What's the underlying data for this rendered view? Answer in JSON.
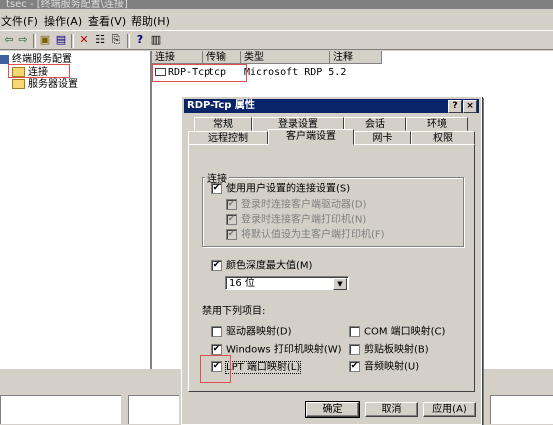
{
  "window": {
    "title": "tsec - [终端服务配置\\连接]"
  },
  "menu": [
    "文件(F)",
    "操作(A)",
    "查看(V)",
    "帮助(H)"
  ],
  "toolbar": {
    "icons": [
      "back-icon",
      "forward-icon",
      "folder-up-icon",
      "show-tree-icon",
      "delete-icon",
      "properties-icon",
      "export-icon",
      "help-icon",
      "view-icon"
    ],
    "glyphs": [
      "⇦",
      "⇨",
      "▣",
      "▤",
      "✕",
      "☷",
      "⎘",
      "?",
      "▥"
    ]
  },
  "tree": {
    "root": "终端服务配置",
    "items": [
      "连接",
      "服务器设置"
    ]
  },
  "list": {
    "columns": [
      "连接",
      "传输",
      "类型",
      "注释"
    ],
    "rows": [
      {
        "name": "RDP-Tcp",
        "transport": "tcp",
        "type": "Microsoft RDP 5.2",
        "comment": ""
      }
    ]
  },
  "dialog": {
    "title": "RDP-Tcp 属性",
    "help_btn": "?",
    "close_btn": "×",
    "tabs_back": [
      "常规",
      "登录设置",
      "会话",
      "环境"
    ],
    "tabs_front": [
      "远程控制",
      "客户端设置",
      "网卡",
      "权限"
    ],
    "connection_group": {
      "label": "连接",
      "use_user_settings": "使用用户设置的连接设置(S)",
      "items": [
        "登录时连接客户端驱动器(D)",
        "登录时连接客户端打印机(N)",
        "将默认值设为主客户端打印机(F)"
      ]
    },
    "color_depth": {
      "label": "颜色深度最大值(M)",
      "value": "16 位"
    },
    "disable_section": {
      "label": "禁用下列项目:",
      "left": [
        {
          "label": "驱动器映射(D)",
          "checked": false
        },
        {
          "label": "Windows 打印机映射(W)",
          "checked": true
        },
        {
          "label": "LPT 端口映射(L)",
          "checked": true
        }
      ],
      "right": [
        {
          "label": "COM 端口映射(C)",
          "checked": false
        },
        {
          "label": "剪贴板映射(B)",
          "checked": false
        },
        {
          "label": "音频映射(U)",
          "checked": true
        }
      ]
    },
    "buttons": {
      "ok": "确定",
      "cancel": "取消",
      "apply": "应用(A)"
    }
  },
  "colors": {
    "titlebar": "#0a246a",
    "highlight_annotation": "#e05050",
    "face": "#d4d0c8"
  }
}
